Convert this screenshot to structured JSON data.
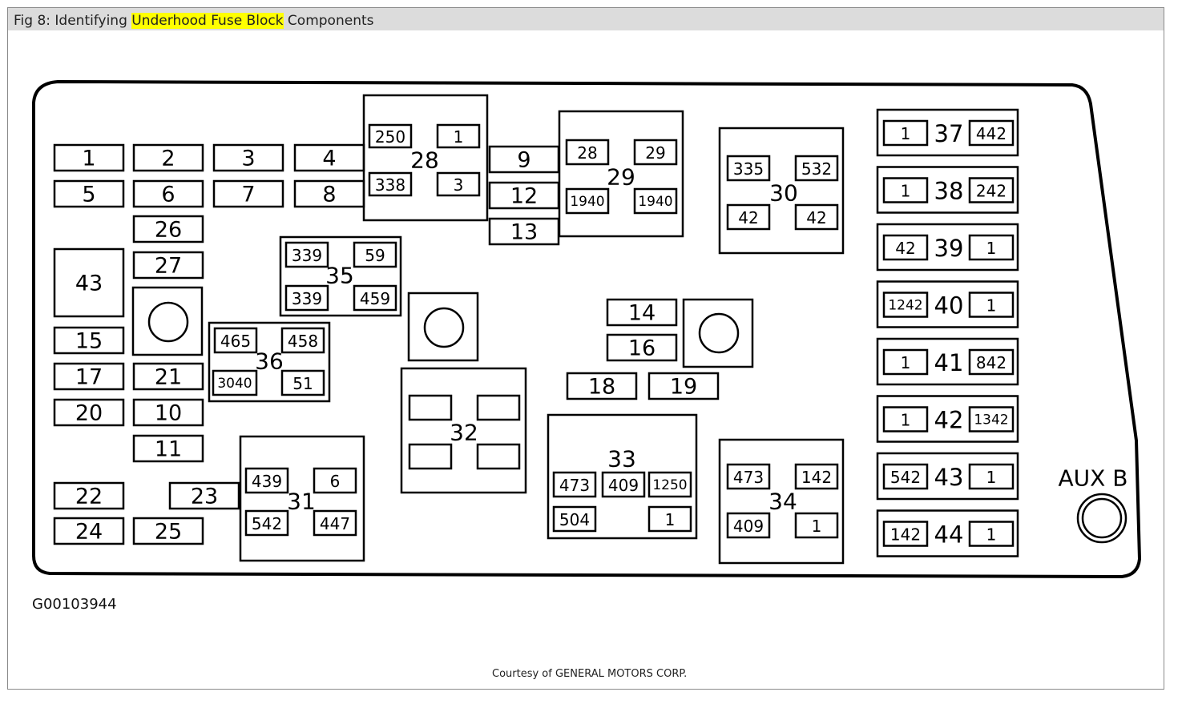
{
  "title": {
    "prefix": "Fig 8: Identifying ",
    "highlight": "Underhood Fuse Block",
    "suffix": " Components"
  },
  "highlight_color": "#ffff00",
  "figure_id": "G00103944",
  "courtesy": "Courtesy of GENERAL MOTORS CORP.",
  "aux_label": "AUX B",
  "fuses": [
    "1",
    "2",
    "3",
    "4",
    "5",
    "6",
    "7",
    "8",
    "26",
    "27",
    "43",
    "15",
    "17",
    "20",
    "21",
    "10",
    "11",
    "22",
    "24",
    "23",
    "25",
    "9",
    "12",
    "13",
    "14",
    "16",
    "18",
    "19"
  ],
  "relays": [
    {
      "id": "28",
      "pins": [
        "250",
        "1",
        "338",
        "3"
      ]
    },
    {
      "id": "29",
      "pins": [
        "28",
        "29",
        "1940",
        "1940"
      ]
    },
    {
      "id": "30",
      "pins": [
        "335",
        "532",
        "42",
        "42"
      ]
    },
    {
      "id": "35",
      "pins": [
        "339",
        "59",
        "339",
        "459"
      ]
    },
    {
      "id": "36",
      "pins": [
        "465",
        "458",
        "3040",
        "51"
      ]
    },
    {
      "id": "31",
      "pins": [
        "439",
        "6",
        "542",
        "447"
      ]
    },
    {
      "id": "32",
      "pins": [
        "",
        "",
        "",
        ""
      ]
    },
    {
      "id": "33",
      "pins": [
        "473",
        "409",
        "1250",
        "504",
        "1"
      ]
    },
    {
      "id": "34",
      "pins": [
        "473",
        "142",
        "409",
        "1"
      ]
    }
  ],
  "side_relays": [
    {
      "id": "37",
      "left": "1",
      "right": "442"
    },
    {
      "id": "38",
      "left": "1",
      "right": "242"
    },
    {
      "id": "39",
      "left": "42",
      "right": "1"
    },
    {
      "id": "40",
      "left": "1242",
      "right": "1"
    },
    {
      "id": "41",
      "left": "1",
      "right": "842"
    },
    {
      "id": "42",
      "left": "1",
      "right": "1342"
    },
    {
      "id": "43",
      "left": "542",
      "right": "1"
    },
    {
      "id": "44",
      "left": "142",
      "right": "1"
    }
  ]
}
